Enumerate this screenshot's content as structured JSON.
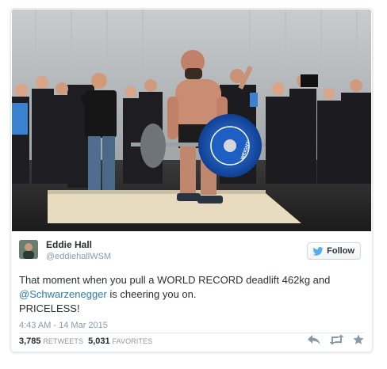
{
  "tweet": {
    "author_name": "Eddie Hall",
    "author_handle": "@eddiehallWSM",
    "follow_label": "Follow",
    "text_part1": "That moment when you pull a WORLD RECORD deadlift 462kg and",
    "mention": "@Schwarzenegger",
    "text_part2": " is cheering you on.",
    "text_line3": "PRICELESS!",
    "timestamp": "4:43 AM - 14 Mar 2015",
    "retweets_count": "3,785",
    "retweets_label": "RETWEETS",
    "favorites_count": "5,031",
    "favorites_label": "FAVORITES"
  },
  "media": {
    "description_icon": "photo-deadlift",
    "plate_text": "WEIGHT"
  },
  "icons": {
    "follow": "bird-icon",
    "reply": "reply-icon",
    "retweet": "retweet-icon",
    "favorite": "star-icon"
  },
  "colors": {
    "link": "#2b7bb9",
    "muted": "#8899a6",
    "text": "#292f33",
    "plate_blue": "#1d5fc2"
  }
}
